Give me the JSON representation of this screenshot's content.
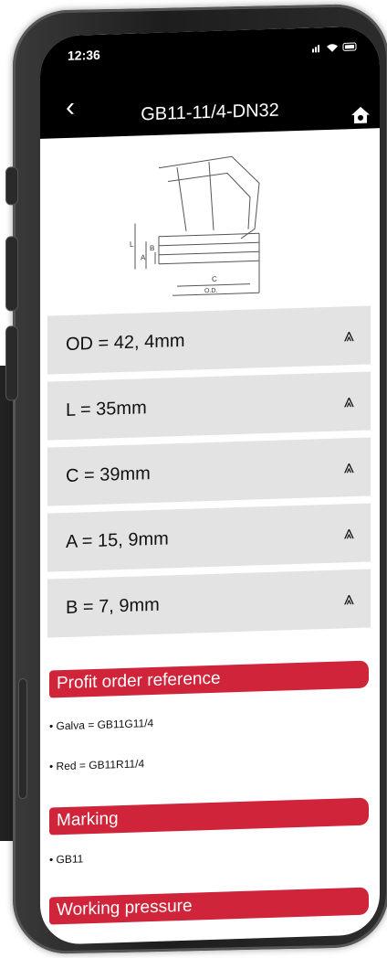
{
  "status_bar": {
    "time": "12:36",
    "icons": "signal wifi battery"
  },
  "header": {
    "back_icon": "chevron-left-icon",
    "title": "GB11-11/4-DN32",
    "home_icon": "home-icon"
  },
  "diagram": {
    "labels": {
      "l": "L",
      "b": "B",
      "a": "A",
      "c": "C",
      "od": "O.D."
    }
  },
  "specs": [
    {
      "label": "OD = 42, 4mm"
    },
    {
      "label": "L = 35mm"
    },
    {
      "label": "C = 39mm"
    },
    {
      "label": "A = 15, 9mm"
    },
    {
      "label": "B = 7, 9mm"
    }
  ],
  "sections": {
    "profit": {
      "title": "Profit order reference",
      "items": [
        "Galva = GB11G11/4",
        "Red = GB11R11/4"
      ]
    },
    "marking": {
      "title": "Marking",
      "items": [
        "GB11"
      ]
    },
    "pressure": {
      "title": "Working pressure"
    }
  },
  "colors": {
    "accent": "#d0243a",
    "row_bg": "#e3e3e3",
    "header_bg": "#000000"
  }
}
